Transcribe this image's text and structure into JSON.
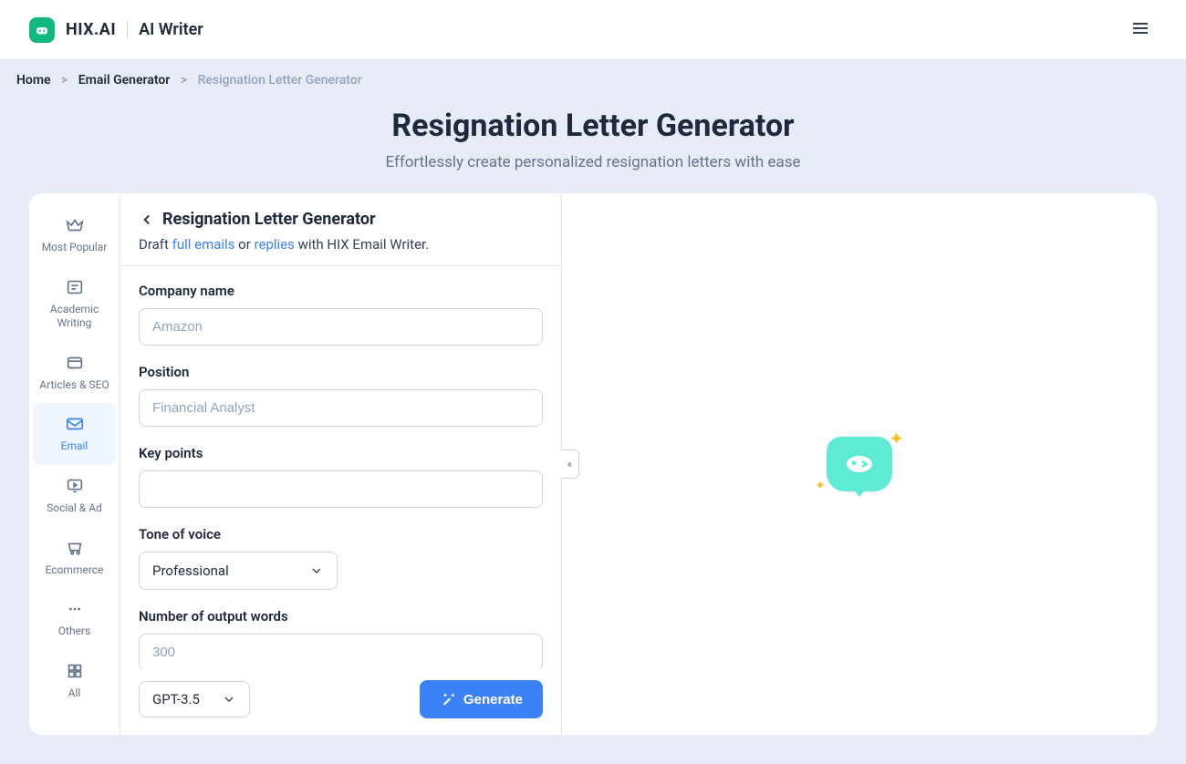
{
  "brand": {
    "name": "HIX.AI",
    "product": "AI Writer"
  },
  "breadcrumb": {
    "home": "Home",
    "email": "Email Generator",
    "current": "Resignation Letter Generator"
  },
  "hero": {
    "title": "Resignation Letter Generator",
    "subtitle": "Effortlessly create personalized resignation letters with ease"
  },
  "sidebar": {
    "items": [
      {
        "label": "Most Popular"
      },
      {
        "label": "Academic Writing"
      },
      {
        "label": "Articles & SEO"
      },
      {
        "label": "Email"
      },
      {
        "label": "Social & Ad"
      },
      {
        "label": "Ecommerce"
      },
      {
        "label": "Others"
      },
      {
        "label": "All"
      }
    ]
  },
  "form": {
    "title": "Resignation Letter Generator",
    "draft_prefix": "Draft ",
    "full_emails": "full emails",
    "or": " or ",
    "replies": "replies",
    "draft_suffix": " with HIX Email Writer.",
    "company_label": "Company name",
    "company_placeholder": "Amazon",
    "position_label": "Position",
    "position_placeholder": "Financial Analyst",
    "keypoints_label": "Key points",
    "tone_label": "Tone of voice",
    "tone_value": "Professional",
    "words_label": "Number of output words",
    "words_placeholder": "300",
    "model": "GPT-3.5",
    "generate": "Generate"
  }
}
